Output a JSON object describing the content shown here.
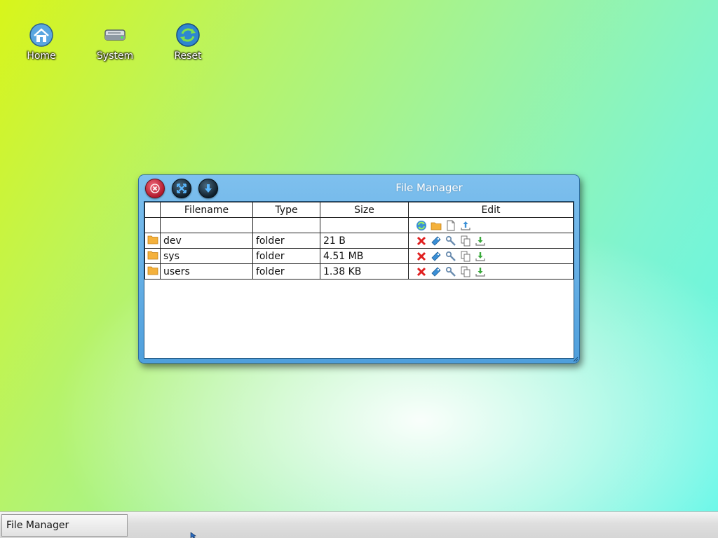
{
  "desktop": {
    "icons": [
      {
        "label": "Home",
        "icon": "home-icon"
      },
      {
        "label": "System",
        "icon": "drive-icon"
      },
      {
        "label": "Reset",
        "icon": "reset-icon"
      }
    ]
  },
  "window": {
    "title": "File Manager",
    "buttons": [
      "close-icon",
      "maximize-icon",
      "minimize-icon"
    ],
    "table": {
      "headers": [
        "Filename",
        "Type",
        "Size",
        "Edit"
      ],
      "toolbar_icons": [
        "refresh-icon",
        "new-folder-icon",
        "new-file-icon",
        "upload-icon"
      ],
      "rows": [
        {
          "name": "dev",
          "type": "folder",
          "size": "21 B"
        },
        {
          "name": "sys",
          "type": "folder",
          "size": "4.51 MB"
        },
        {
          "name": "users",
          "type": "folder",
          "size": "1.38 KB"
        }
      ],
      "row_icons": [
        "delete-icon",
        "rename-icon",
        "properties-icon",
        "copy-icon",
        "download-icon"
      ]
    }
  },
  "taskbar": {
    "items": [
      {
        "label": "File Manager"
      }
    ]
  },
  "colors": {
    "window_blue": "#4f9fdc",
    "close_red": "#b21a2e",
    "folder_orange": "#f4b13c"
  }
}
